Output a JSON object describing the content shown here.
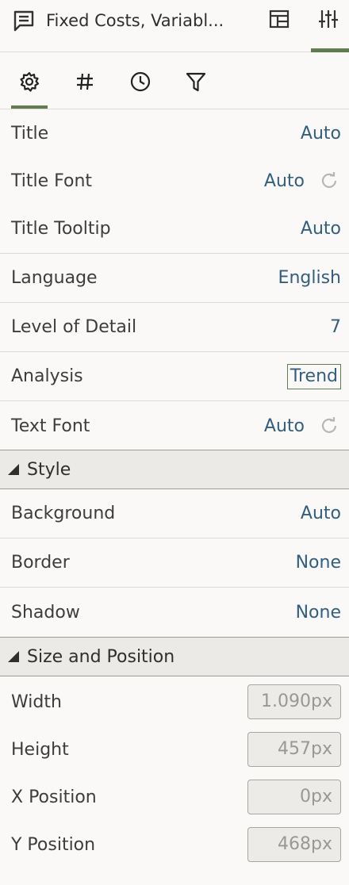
{
  "header": {
    "title": "Fixed Costs, Variabl...",
    "icons": {
      "doc": "comment-doc-icon",
      "layout": "layout-panel-icon",
      "properties": "sliders-icon"
    }
  },
  "tabs": [
    {
      "name": "general",
      "icon": "gear-icon",
      "active": true
    },
    {
      "name": "number-format",
      "icon": "hash-icon",
      "active": false
    },
    {
      "name": "time",
      "icon": "clock-icon",
      "active": false
    },
    {
      "name": "filter",
      "icon": "filter-icon",
      "active": false
    }
  ],
  "general": {
    "title": {
      "label": "Title",
      "value": "Auto"
    },
    "title_font": {
      "label": "Title Font",
      "value": "Auto"
    },
    "title_tooltip": {
      "label": "Title Tooltip",
      "value": "Auto"
    },
    "language": {
      "label": "Language",
      "value": "English"
    },
    "level_of_detail": {
      "label": "Level of Detail",
      "value": "7"
    },
    "analysis": {
      "label": "Analysis",
      "value": "Trend"
    },
    "text_font": {
      "label": "Text Font",
      "value": "Auto"
    }
  },
  "style": {
    "header": "Style",
    "background": {
      "label": "Background",
      "value": "Auto"
    },
    "border": {
      "label": "Border",
      "value": "None"
    },
    "shadow": {
      "label": "Shadow",
      "value": "None"
    }
  },
  "size_position": {
    "header": "Size and Position",
    "width": {
      "label": "Width",
      "value": "1.090px"
    },
    "height": {
      "label": "Height",
      "value": "457px"
    },
    "x": {
      "label": "X Position",
      "value": "0px"
    },
    "y": {
      "label": "Y Position",
      "value": "468px"
    }
  },
  "colors": {
    "accent": "#5f7d4f",
    "link": "#2f5f82",
    "section_bg": "#eceae6"
  }
}
